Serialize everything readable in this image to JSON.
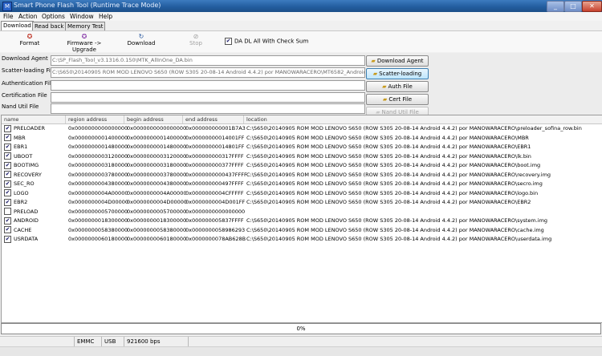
{
  "window": {
    "title": "Smart Phone Flash Tool (Runtime Trace Mode)",
    "minimize": "_",
    "maximize": "□",
    "close": "✕"
  },
  "menu": [
    "File",
    "Action",
    "Options",
    "Window",
    "Help"
  ],
  "tabs": [
    "Download",
    "Read back",
    "Memory Test"
  ],
  "toolbar": {
    "format": "Format",
    "firmware_upgrade": "Firmware -> Upgrade",
    "download": "Download",
    "stop": "Stop",
    "da_dl_all": "DA DL All With Check Sum"
  },
  "fields": [
    {
      "label": "Download Agent",
      "value": "C:\\SP_Flash_Tool_v3.1316.0.150\\MTK_AllInOne_DA.bin",
      "button": "Download Agent"
    },
    {
      "label": "Scatter-loading File",
      "value": "C:\\S650\\20140905 ROM MOD LENOVO S650 (ROW S305 20-08-14 Android 4.4.2) por MANOWARACERO\\MT6582_Android_",
      "button": "Scatter-loading"
    },
    {
      "label": "Authentication File",
      "value": "",
      "button": "Auth File"
    },
    {
      "label": "Certification File",
      "value": "",
      "button": "Cert File"
    },
    {
      "label": "Nand Util File",
      "value": "",
      "button": "Nand Util File"
    }
  ],
  "table": {
    "columns": [
      "name",
      "region address",
      "begin address",
      "end address",
      "location"
    ],
    "rows": [
      {
        "checked": true,
        "name": "PRELOADER",
        "region": "0x0000000000000000",
        "begin": "0x0000000000000000",
        "end": "0x000000000001B7A3",
        "location": "C:\\S650\\20140905 ROM MOD LENOVO S650 (ROW S305 20-08-14 Android 4.4.2) por MANOWARACERO\\preloader_sofina_row.bin"
      },
      {
        "checked": true,
        "name": "MBR",
        "region": "0x0000000001400000",
        "begin": "0x0000000001400000",
        "end": "0x00000000014001FF",
        "location": "C:\\S650\\20140905 ROM MOD LENOVO S650 (ROW S305 20-08-14 Android 4.4.2) por MANOWARACERO\\MBR"
      },
      {
        "checked": true,
        "name": "EBR1",
        "region": "0x0000000001480000",
        "begin": "0x0000000001480000",
        "end": "0x00000000014801FF",
        "location": "C:\\S650\\20140905 ROM MOD LENOVO S650 (ROW S305 20-08-14 Android 4.4.2) por MANOWARACERO\\EBR1"
      },
      {
        "checked": true,
        "name": "UBOOT",
        "region": "0x0000000003120000",
        "begin": "0x0000000003120000",
        "end": "0x000000000317FFFF",
        "location": "C:\\S650\\20140905 ROM MOD LENOVO S650 (ROW S305 20-08-14 Android 4.4.2) por MANOWARACERO\\lk.bin"
      },
      {
        "checked": true,
        "name": "BOOTIMG",
        "region": "0x0000000003180000",
        "begin": "0x0000000003180000",
        "end": "0x000000000377FFFF",
        "location": "C:\\S650\\20140905 ROM MOD LENOVO S650 (ROW S305 20-08-14 Android 4.4.2) por MANOWARACERO\\boot.img"
      },
      {
        "checked": true,
        "name": "RECOVERY",
        "region": "0x0000000003780000",
        "begin": "0x0000000003780000",
        "end": "0x0000000000437FFFF",
        "location": "C:\\S650\\20140905 ROM MOD LENOVO S650 (ROW S305 20-08-14 Android 4.4.2) por MANOWARACERO\\recovery.img"
      },
      {
        "checked": true,
        "name": "SEC_RO",
        "region": "0x0000000004380000",
        "begin": "0x0000000004380000",
        "end": "0x000000000497FFFF",
        "location": "C:\\S650\\20140905 ROM MOD LENOVO S650 (ROW S305 20-08-14 Android 4.4.2) por MANOWARACERO\\secro.img"
      },
      {
        "checked": true,
        "name": "LOGO",
        "region": "0x0000000004A00000",
        "begin": "0x0000000004A00000",
        "end": "0x0000000004CFFFFF",
        "location": "C:\\S650\\20140905 ROM MOD LENOVO S650 (ROW S305 20-08-14 Android 4.4.2) por MANOWARACERO\\logo.bin"
      },
      {
        "checked": true,
        "name": "EBR2",
        "region": "0x0000000004D00000",
        "begin": "0x0000000004D00000",
        "end": "0x0000000004D001FF",
        "location": "C:\\S650\\20140905 ROM MOD LENOVO S650 (ROW S305 20-08-14 Android 4.4.2) por MANOWARACERO\\EBR2"
      },
      {
        "checked": false,
        "name": "PRELOAD",
        "region": "0x0000000005700000",
        "begin": "0x0000000005700000",
        "end": "0x0000000000000000",
        "location": ""
      },
      {
        "checked": true,
        "name": "ANDROID",
        "region": "0x0000000018300000",
        "begin": "0x0000000018300000",
        "end": "0x000000005837FFFF",
        "location": "C:\\S650\\20140905 ROM MOD LENOVO S650 (ROW S305 20-08-14 Android 4.4.2) por MANOWARACERO\\system.img"
      },
      {
        "checked": true,
        "name": "CACHE",
        "region": "0x0000000058380000",
        "begin": "0x0000000058380000",
        "end": "0x0000000058986293",
        "location": "C:\\S650\\20140905 ROM MOD LENOVO S650 (ROW S305 20-08-14 Android 4.4.2) por MANOWARACERO\\cache.img"
      },
      {
        "checked": true,
        "name": "USRDATA",
        "region": "0x0000000060180000",
        "begin": "0x0000000060180000",
        "end": "0x0000000078AB628B",
        "location": "C:\\S650\\20140905 ROM MOD LENOVO S650 (ROW S305 20-08-14 Android 4.4.2) por MANOWARACERO\\userdata.img"
      }
    ]
  },
  "progress": {
    "text": "0%",
    "value": 0
  },
  "status": {
    "storage": "EMMC",
    "port": "USB",
    "baud": "921600 bps"
  },
  "colors": {
    "titlebar": "#235ea0",
    "active_button": "#bee6fd"
  }
}
